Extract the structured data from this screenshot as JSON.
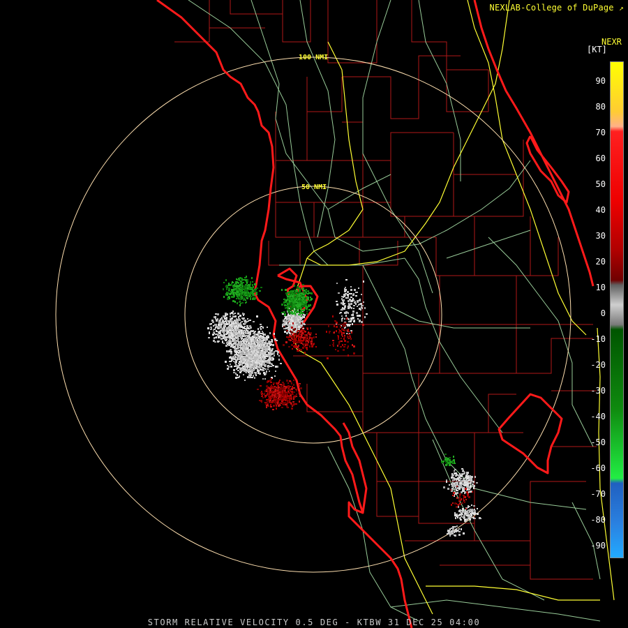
{
  "credit": "NEXLAB-College of DuPage",
  "credit_icon": "external-link-icon",
  "legend": {
    "title": "NEXR",
    "unit": "[KT]",
    "ticks": [
      "90",
      "80",
      "70",
      "60",
      "50",
      "40",
      "30",
      "20",
      "10",
      "0",
      "-10",
      "-20",
      "-30",
      "-40",
      "-50",
      "-60",
      "-70",
      "-80",
      "-90"
    ]
  },
  "rings": [
    "100 NMI",
    "50 NMI"
  ],
  "footer": "STORM RELATIVE VELOCITY 0.5 DEG - KTBW 31 DEC 25 04:00",
  "colors": {
    "background": "#000000",
    "coastline": "#ff1a1a",
    "county": "#b01818",
    "highway": "#ffff33",
    "road": "#99cc99",
    "ring": "#ffe0b0",
    "label": "#ffff33"
  }
}
